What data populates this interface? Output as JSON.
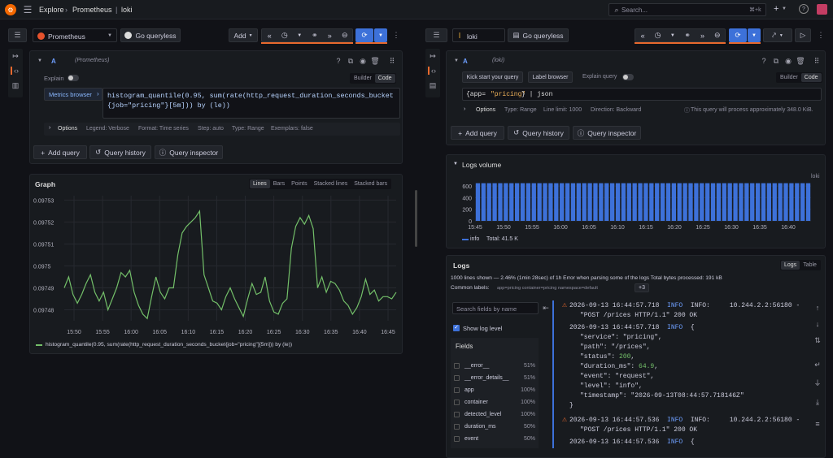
{
  "topbar": {
    "explore": "Explore",
    "sep1": "›",
    "prometheus": "Prometheus",
    "sep2": "|",
    "loki": "loki",
    "search_placeholder": "Search...",
    "shortcut": "⌘+k",
    "plus": "+"
  },
  "left": {
    "datasource": "Prometheus",
    "go_queryless": "Go queryless",
    "add": "Add",
    "query_letter": "A",
    "query_ds": "(Prometheus)",
    "explain": "Explain",
    "builder": "Builder",
    "code": "Code",
    "metrics_browser": "Metrics browser",
    "query_line1": "histogram_quantile(0.95, sum(rate(http_request_duration_seconds_bucket",
    "query_line2": "{job=\"pricing\"}[5m])) by (le))",
    "options": "Options",
    "legend": "Legend: Verbose",
    "format": "Format: Time series",
    "step": "Step: auto",
    "type": "Type: Range",
    "exemplars": "Exemplars: false",
    "add_query": "Add query",
    "query_history": "Query history",
    "query_inspector": "Query inspector",
    "graph_title": "Graph",
    "graph_modes": [
      "Lines",
      "Bars",
      "Points",
      "Stacked lines",
      "Stacked bars"
    ],
    "legend_entry": "histogram_quantile(0.95, sum(rate(http_request_duration_seconds_bucket{job=\"pricing\"}[5m])) by (le))"
  },
  "right": {
    "datasource": "loki",
    "go_queryless": "Go queryless",
    "query_letter": "A",
    "query_ds": "(loki)",
    "kick_start": "Kick start your query",
    "label_browser": "Label browser",
    "explain_query": "Explain query",
    "builder": "Builder",
    "code": "Code",
    "query_p1": "{app=",
    "query_p2": "\"pricing\"",
    "query_p3": "} | json",
    "options": "Options",
    "type": "Type: Range",
    "line_limit": "Line limit: 1000",
    "direction": "Direction: Backward",
    "info_note": "This query will process approximately 348.0 KiB.",
    "add_query": "Add query",
    "query_history": "Query history",
    "query_inspector": "Query inspector",
    "logs_volume": "Logs volume",
    "series_label": "loki",
    "legend_info": "info",
    "legend_total": "Total: 41.5 K",
    "logs_title": "Logs",
    "logs_tabs": [
      "Logs",
      "Table"
    ],
    "stats": "1000 lines shown — 2.46% (1min 28sec) of 1h  Error when parsing some of the logs  Total bytes processed: 191 kB",
    "common_labels_label": "Common labels:",
    "common_labels": "app=pricing container=pricing namespace=default",
    "more": "+3",
    "search_fields": "Search fields by name",
    "show_log_level": "Show log level",
    "fields_title": "Fields",
    "fields": [
      {
        "name": "__error__",
        "pct": "51%"
      },
      {
        "name": "__error_details__",
        "pct": "51%"
      },
      {
        "name": "app",
        "pct": "100%"
      },
      {
        "name": "container",
        "pct": "100%"
      },
      {
        "name": "detected_level",
        "pct": "100%"
      },
      {
        "name": "duration_ms",
        "pct": "50%"
      },
      {
        "name": "event",
        "pct": "50%"
      }
    ],
    "logs": {
      "l1": "2026-09-13 16:44:57.718  ",
      "l1lvl": "INFO",
      "l1b": "  INFO:     10.244.2.2:56180 -",
      "l1c": "\"POST /prices HTTP/1.1\" 200 OK",
      "l2": "2026-09-13 16:44:57.718  ",
      "l2lvl": "INFO",
      "l2b": "  {",
      "j1": "\"service\": \"pricing\",",
      "j2": "\"path\": \"/prices\",",
      "j3a": "\"status\": ",
      "j3b": "200",
      "j3c": ",",
      "j4a": "\"duration_ms\": ",
      "j4b": "64.9",
      "j4c": ",",
      "j5": "\"event\": \"request\",",
      "j6": "\"level\": \"info\",",
      "j7": "\"timestamp\": \"2026-09-13T08:44:57.718146Z\"",
      "j8": "}",
      "l3": "2026-09-13 16:44:57.536  ",
      "l3lvl": "INFO",
      "l3b": "  INFO:     10.244.2.2:56180 -",
      "l3c": "\"POST /prices HTTP/1.1\" 200 OK",
      "l4": "2026-09-13 16:44:57.536  ",
      "l4lvl": "INFO",
      "l4b": "  {"
    }
  },
  "colors": {
    "accent": "#3d71d9",
    "line": "#73bf69",
    "bar": "#3d71d9",
    "warn": "#e8692e"
  },
  "chart_data": [
    {
      "type": "line",
      "title": "Graph",
      "x": [
        "15:50",
        "15:55",
        "16:00",
        "16:05",
        "16:10",
        "16:15",
        "16:20",
        "16:25",
        "16:30",
        "16:35",
        "16:40",
        "16:45"
      ],
      "yticks": [
        "0.09753",
        "0.09752",
        "0.09751",
        "0.0975",
        "0.09749",
        "0.09748"
      ],
      "ylim": [
        0.097475,
        0.097532
      ],
      "series": [
        {
          "name": "histogram_quantile(0.95, sum(rate(http_request_duration_seconds_bucket{job=\"pricing\"}[5m])) by (le))",
          "values": [
            0.09749,
            0.097495,
            0.097487,
            0.097483,
            0.097487,
            0.097492,
            0.097496,
            0.097488,
            0.097484,
            0.097488,
            0.09748,
            0.097485,
            0.09749,
            0.097497,
            0.097495,
            0.097498,
            0.097488,
            0.097482,
            0.097478,
            0.097476,
            0.097486,
            0.097495,
            0.097488,
            0.097485,
            0.09749,
            0.09749,
            0.097505,
            0.097515,
            0.097518,
            0.09752,
            0.097522,
            0.097525,
            0.097496,
            0.09749,
            0.097484,
            0.097483,
            0.09748,
            0.097486,
            0.09749,
            0.097485,
            0.097481,
            0.097477,
            0.097485,
            0.097492,
            0.097487,
            0.097488,
            0.097495,
            0.097484,
            0.097479,
            0.097478,
            0.097483,
            0.097485,
            0.097508,
            0.097518,
            0.097522,
            0.097519,
            0.097523,
            0.097517,
            0.09749,
            0.097495,
            0.097488,
            0.097493,
            0.097492,
            0.097489,
            0.097484,
            0.097482,
            0.097478,
            0.097481,
            0.097486,
            0.097494,
            0.097487,
            0.097489,
            0.097484,
            0.097486,
            0.097486,
            0.097485,
            0.097488
          ]
        }
      ]
    },
    {
      "type": "bar",
      "title": "Logs volume",
      "x": [
        "15:45",
        "15:50",
        "15:55",
        "16:00",
        "16:05",
        "16:10",
        "16:15",
        "16:20",
        "16:25",
        "16:30",
        "16:35",
        "16:40"
      ],
      "yticks": [
        "600",
        "400",
        "200",
        "0"
      ],
      "ylim": [
        0,
        700
      ],
      "series": [
        {
          "name": "info",
          "value_each": 650
        }
      ]
    }
  ]
}
